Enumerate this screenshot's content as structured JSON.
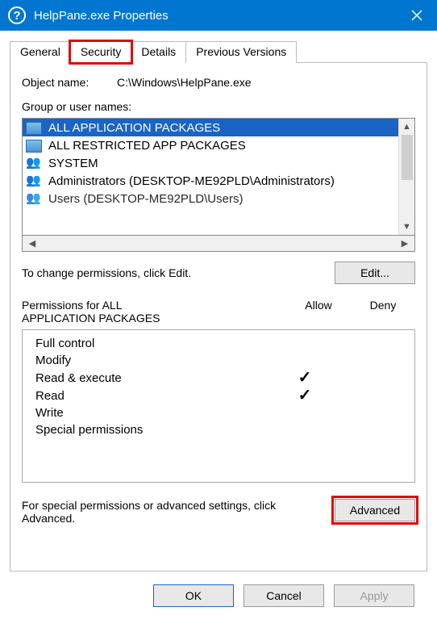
{
  "titlebar": {
    "title": "HelpPane.exe Properties"
  },
  "tabs": {
    "general": "General",
    "security": "Security",
    "details": "Details",
    "previous_versions": "Previous Versions"
  },
  "object": {
    "label": "Object name:",
    "value": "C:\\Windows\\HelpPane.exe"
  },
  "group_label": "Group or user names:",
  "principals": [
    {
      "name": "ALL APPLICATION PACKAGES",
      "icon": "pkg",
      "selected": true
    },
    {
      "name": "ALL RESTRICTED APP PACKAGES",
      "icon": "pkg",
      "selected": false
    },
    {
      "name": "SYSTEM",
      "icon": "users",
      "selected": false
    },
    {
      "name": "Administrators (DESKTOP-ME92PLD\\Administrators)",
      "icon": "users",
      "selected": false
    },
    {
      "name": "Users (DESKTOP-ME92PLD\\Users)",
      "icon": "users",
      "selected": false,
      "clipped": true
    }
  ],
  "edit_hint": "To change permissions, click Edit.",
  "edit_btn": "Edit...",
  "perm_header": {
    "title_prefix": "Permissions for ALL",
    "title_line2": "APPLICATION PACKAGES",
    "allow": "Allow",
    "deny": "Deny"
  },
  "permissions": [
    {
      "name": "Full control",
      "allow": false,
      "deny": false
    },
    {
      "name": "Modify",
      "allow": false,
      "deny": false
    },
    {
      "name": "Read & execute",
      "allow": true,
      "deny": false
    },
    {
      "name": "Read",
      "allow": true,
      "deny": false
    },
    {
      "name": "Write",
      "allow": false,
      "deny": false
    },
    {
      "name": "Special permissions",
      "allow": false,
      "deny": false
    }
  ],
  "advanced": {
    "text": "For special permissions or advanced settings, click Advanced.",
    "btn": "Advanced"
  },
  "buttons": {
    "ok": "OK",
    "cancel": "Cancel",
    "apply": "Apply"
  }
}
